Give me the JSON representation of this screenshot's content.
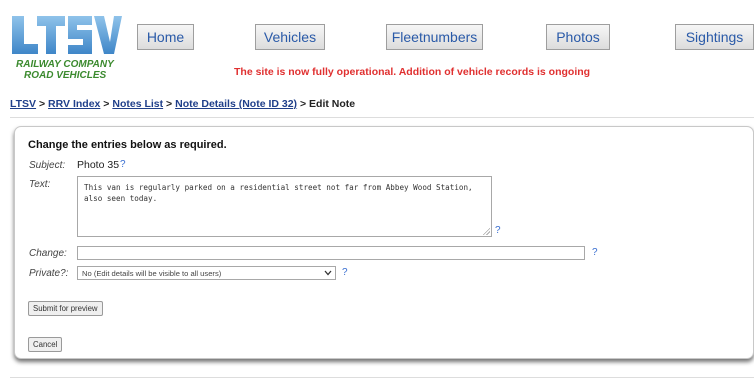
{
  "logo": {
    "text_line1": "RAILWAY COMPANY",
    "text_line2": "ROAD VEHICLES",
    "mark_color": "#4f9dd6"
  },
  "nav": {
    "home": "Home",
    "vehicles": "Vehicles",
    "fleetnumbers": "Fleetnumbers",
    "photos": "Photos",
    "sightings": "Sightings"
  },
  "status_message": "The site is now fully operational. Addition of vehicle records is ongoing",
  "breadcrumb": {
    "items": [
      "LTSV",
      "RRV Index",
      "Notes List",
      "Note Details (Note ID 32)"
    ],
    "current": "Edit Note",
    "separator": ">"
  },
  "form": {
    "heading": "Change the entries below as required.",
    "subject_label": "Subject:",
    "subject_value": "Photo 35",
    "text_label": "Text:",
    "text_value": "This van is regularly parked on a residential street not far from Abbey Wood Station, also seen today.",
    "change_label": "Change:",
    "change_value": "",
    "private_label": "Private?:",
    "private_selected": "No (Edit details will be visible to all users)",
    "help_mark": "?",
    "submit_label": "Submit for preview",
    "cancel_label": "Cancel"
  },
  "colors": {
    "status_red": "#e03030",
    "logo_green": "#3b8a2e",
    "link_blue": "#1f3f8a",
    "nav_text": "#2a5aa8"
  }
}
